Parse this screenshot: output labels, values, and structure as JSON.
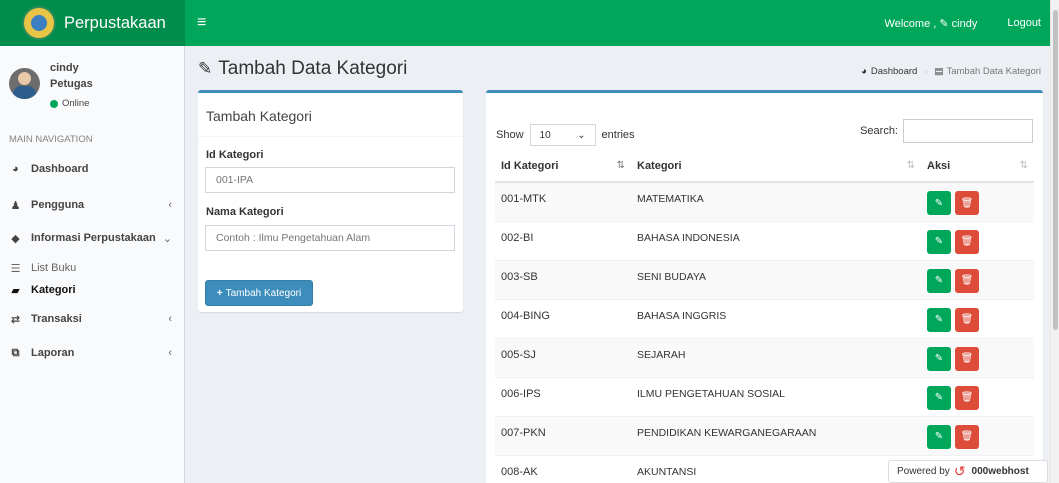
{
  "header": {
    "brand": "Perpustakaan",
    "menu_icon": "bars-icon",
    "welcome": "Welcome ,",
    "welcome_user": "cindy",
    "logout": "Logout",
    "accent": "#00a65a"
  },
  "sidebar": {
    "user": {
      "name": "cindy",
      "role": "Petugas",
      "status": "Online"
    },
    "nav_header": "MAIN NAVIGATION",
    "items": [
      {
        "label": "Dashboard",
        "icon": "dashboard-icon"
      },
      {
        "label": "Pengguna",
        "icon": "user-icon",
        "chevron": "‹"
      },
      {
        "label": "Informasi Perpustakaan",
        "icon": "tag-icon",
        "chevron": "⌄"
      },
      {
        "label": "Transaksi",
        "icon": "exchange-icon",
        "chevron": "‹"
      },
      {
        "label": "Laporan",
        "icon": "copy-icon",
        "chevron": "‹"
      }
    ],
    "subitems": [
      {
        "label": "List Buku",
        "icon": "list-icon"
      },
      {
        "label": "Kategori",
        "icon": "book-icon"
      }
    ]
  },
  "page": {
    "title": "Tambah Data Kategori",
    "breadcrumb": {
      "home": "Dashboard",
      "current": "Tambah Data Kategori"
    }
  },
  "form": {
    "title": "Tambah Kategori",
    "id_label": "Id Kategori",
    "id_value": "001-IPA",
    "name_label": "Nama Kategori",
    "name_placeholder": "Contoh : Ilmu Pengetahuan Alam",
    "submit_label": "Tambah Kategori"
  },
  "table": {
    "show_label": "Show",
    "entries_value": "10",
    "entries_label": "entries",
    "search_label": "Search:",
    "columns": [
      "Id Kategori",
      "Kategori",
      "Aksi"
    ],
    "rows": [
      {
        "id": "001-MTK",
        "kategori": "MATEMATIKA"
      },
      {
        "id": "002-BI",
        "kategori": "BAHASA INDONESIA"
      },
      {
        "id": "003-SB",
        "kategori": "SENI BUDAYA"
      },
      {
        "id": "004-BING",
        "kategori": "BAHASA INGGRIS"
      },
      {
        "id": "005-SJ",
        "kategori": "SEJARAH"
      },
      {
        "id": "006-IPS",
        "kategori": "ILMU PENGETAHUAN SOSIAL"
      },
      {
        "id": "007-PKN",
        "kategori": "PENDIDIKAN KEWARGANEGARAAN"
      },
      {
        "id": "008-AK",
        "kategori": "AKUNTANSI"
      }
    ]
  },
  "footer": {
    "powered_by": "Powered by",
    "host": "000webhost"
  }
}
